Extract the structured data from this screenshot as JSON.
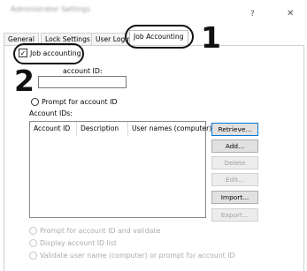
{
  "window": {
    "title": "Administrator Settings",
    "help_label": "?",
    "close_label": "✕"
  },
  "tabs": [
    {
      "label": "General",
      "active": false
    },
    {
      "label": "Lock Settings",
      "active": false
    },
    {
      "label": "User Login",
      "active": false
    },
    {
      "label": "Job Accounting",
      "active": true
    }
  ],
  "job_accounting": {
    "checkbox_label": "Job accounting",
    "checked": true,
    "account_id_label": "account ID:",
    "account_id_value": "",
    "prompt_option": "Prompt for account ID",
    "account_ids_label": "Account IDs:",
    "columns": [
      "Account ID",
      "Description",
      "User names (computer)"
    ],
    "rows": []
  },
  "buttons": {
    "retrieve": "Retrieve...",
    "add": "Add...",
    "delete": "Delete",
    "edit": "Edit...",
    "import": "Import...",
    "export": "Export..."
  },
  "disabled_options": [
    "Prompt for account ID and validate",
    "Display account ID list",
    "Validate user name (computer) or prompt for account ID"
  ],
  "callouts": {
    "one": "1",
    "two": "2"
  }
}
